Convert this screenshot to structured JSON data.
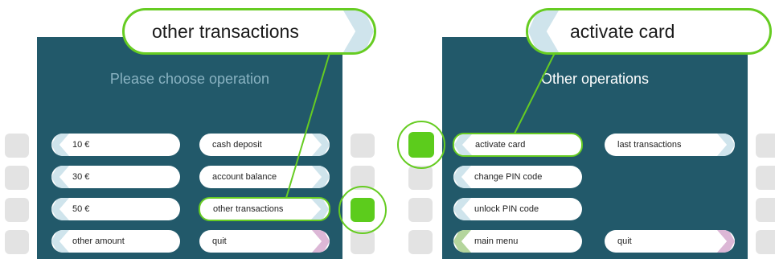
{
  "colors": {
    "screen": "#22596a",
    "accent": "#5ccc1c",
    "cap_blue": "#cfe4ec",
    "cap_green": "#b4d59c",
    "cap_pink": "#dcb7d6",
    "title_muted": "#8ab3c2"
  },
  "left_panel": {
    "callout": "other transactions",
    "title": "Please choose operation",
    "left_options": [
      "10 €",
      "30 €",
      "50 €",
      "other amount"
    ],
    "right_options": [
      "cash deposit",
      "account balance",
      "other transactions",
      "quit"
    ]
  },
  "right_panel": {
    "callout": "activate card",
    "title": "Other operations",
    "left_options": [
      "activate card",
      "change PIN code",
      "unlock PIN code",
      "main menu"
    ],
    "right_options": [
      "last transactions",
      "quit"
    ]
  }
}
